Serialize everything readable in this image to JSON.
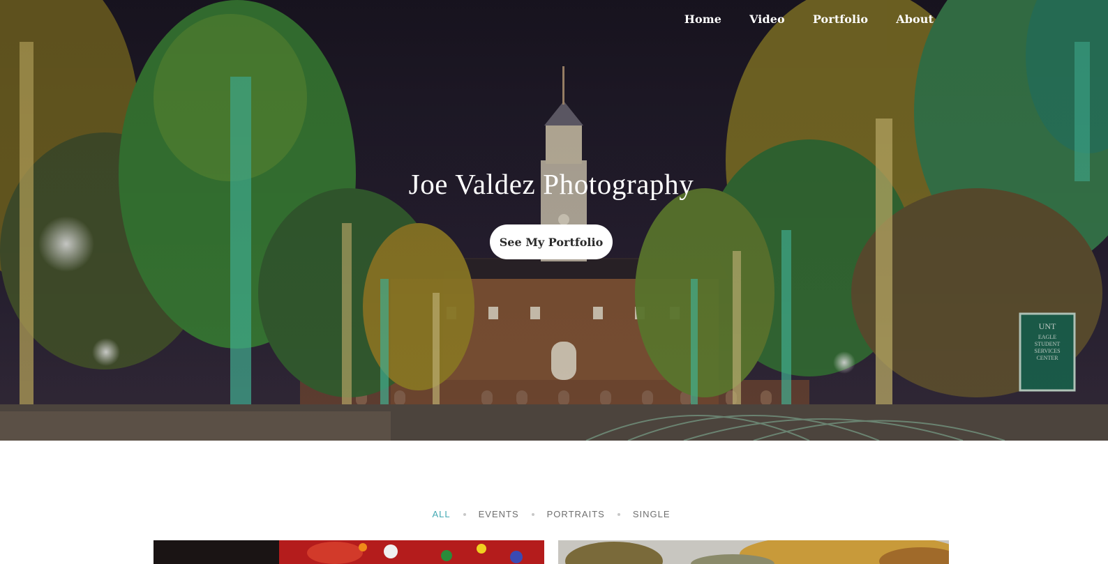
{
  "nav": {
    "items": [
      {
        "label": "Home"
      },
      {
        "label": "Video"
      },
      {
        "label": "Portfolio"
      },
      {
        "label": "About"
      }
    ]
  },
  "hero": {
    "title": "Joe Valdez Photography",
    "cta_label": "See My Portfolio",
    "sign_text": "UNT EAGLE STUDENT SERVICES CENTER"
  },
  "filters": {
    "items": [
      {
        "label": "ALL",
        "active": true
      },
      {
        "label": "EVENTS",
        "active": false
      },
      {
        "label": "PORTRAITS",
        "active": false
      },
      {
        "label": "SINGLE",
        "active": false
      }
    ]
  },
  "colors": {
    "accent": "#43a9b3",
    "filter_text": "#6f6f6f",
    "hero_sky": "#211b2c"
  }
}
